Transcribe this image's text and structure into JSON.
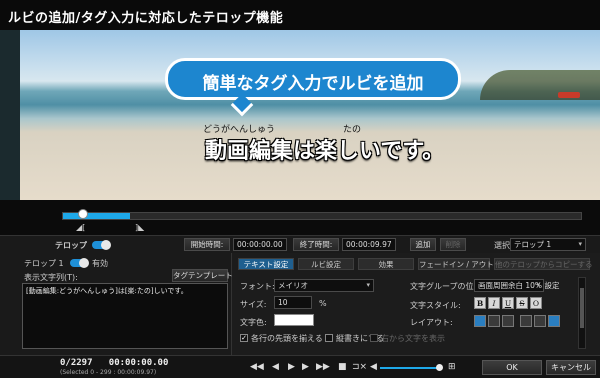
{
  "window": {
    "title": "ルビの追加/タグ入力に対応したテロップ機能"
  },
  "preview": {
    "bubble_text": "簡単なタグ入力でルビを追加",
    "ruby_left": "どうがへんしゅう",
    "ruby_right": "たの",
    "caption": "動画編集は楽しいです。"
  },
  "timeline": {
    "in_mark": "◢[",
    "out_mark": "]◣",
    "progress": 0.13
  },
  "toolbar": {
    "telop_label": "テロップ",
    "start_label": "開始時間:",
    "start_value": "00:00:00.00",
    "end_label": "終了時間:",
    "end_value": "00:00:09.97",
    "add_label": "追加",
    "delete_label": "削除",
    "select_label": "選択:",
    "select_value": "テロップ 1"
  },
  "left_panel": {
    "item_label": "テロップ 1",
    "enabled_label": "有効",
    "text_label": "表示文字列(T):",
    "tag_button": "タグテンプレート",
    "text_value": "[動画編集:どうがへんしゅう]は[楽:たの]しいです。"
  },
  "tabs": [
    "テキスト設定",
    "ルビ設定",
    "効果",
    "フェードイン / アウト",
    "他のテロップからコピーする"
  ],
  "text_settings": {
    "font_label": "フォント:",
    "font_value": "メイリオ",
    "size_label": "サイズ:",
    "size_value": "10",
    "size_unit": "%",
    "color_label": "文字色:",
    "group_pos_label": "文字グループの位置:",
    "group_pos_value": "画面周囲余白 10% 設定",
    "style_label": "文字スタイル:",
    "style_buttons": [
      "B",
      "I",
      "U",
      "S",
      "O"
    ],
    "layout_label": "レイアウト:",
    "check_align": "各行の先頭を揃える",
    "check_vertical": "縦書きにする",
    "check_right": "右から文字を表示"
  },
  "bottom": {
    "frame_counter": "0/2297",
    "timecode": "00:00:00.00",
    "selection": "(Selected 0 - 299 : 00:00:09.97)",
    "ok": "OK",
    "cancel": "キャンセル"
  },
  "icons": [
    "play-icon",
    "pause-icon",
    "stop-icon",
    "prev-frame-icon",
    "next-frame-icon",
    "speaker-icon",
    "expand-icon"
  ]
}
